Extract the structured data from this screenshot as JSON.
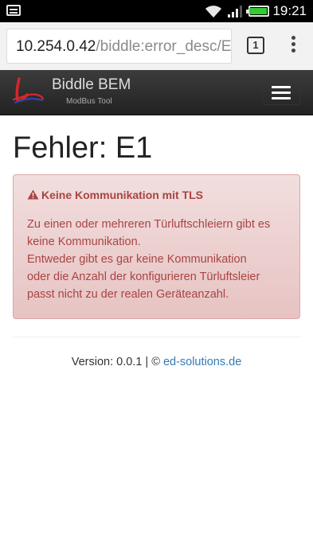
{
  "status_bar": {
    "time": "19:21",
    "battery_level": 1.0,
    "colors": {
      "battery": "#33cc33"
    }
  },
  "browser": {
    "url_host": "10.254.0.42",
    "url_path": "/biddle:error_desc/E",
    "tab_count": "1"
  },
  "navbar": {
    "brand_title": "Biddle BEM",
    "brand_subtitle": "ModBus Tool",
    "toggle_icon": "hamburger-menu-icon"
  },
  "main": {
    "title": "Fehler: E1",
    "alert": {
      "icon": "warning-icon",
      "heading": "Keine Kommunikation mit TLS",
      "lines": [
        "Zu einen oder mehreren Türluftschleiern gibt es",
        "keine Kommunikation.",
        "Entweder gibt es gar keine Kommunikation",
        "oder die Anzahl der konfigurieren Türluftsleier",
        "passt nicht zu der realen Geräteanzahl."
      ],
      "colors": {
        "text": "#a94442",
        "background": "#f2dede"
      }
    }
  },
  "footer": {
    "version_text": "Version: 0.0.1 | © ",
    "link_text": "ed-solutions.de",
    "colors": {
      "link": "#337ab7"
    }
  }
}
